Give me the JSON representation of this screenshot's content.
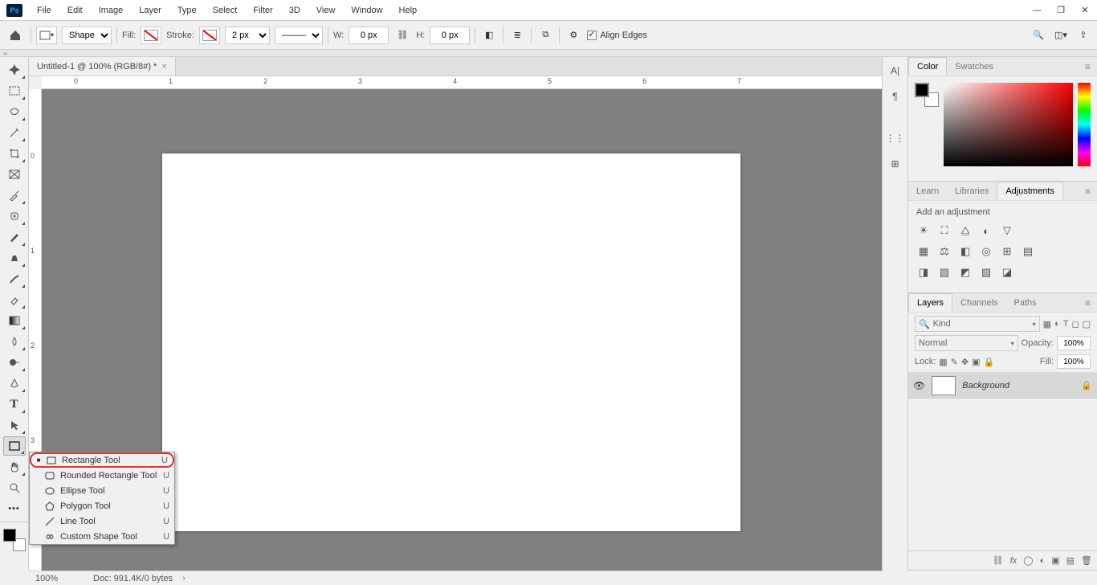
{
  "app": {
    "ps_label": "Ps"
  },
  "menu": [
    "File",
    "Edit",
    "Image",
    "Layer",
    "Type",
    "Select",
    "Filter",
    "3D",
    "View",
    "Window",
    "Help"
  ],
  "options": {
    "mode": "Shape",
    "fill_label": "Fill:",
    "stroke_label": "Stroke:",
    "stroke_width": "2 px",
    "w_label": "W:",
    "w_value": "0 px",
    "h_label": "H:",
    "h_value": "0 px",
    "align_edges": "Align Edges"
  },
  "document": {
    "tab_title": "Untitled-1 @ 100% (RGB/8#) *"
  },
  "ruler_h": [
    "0",
    "1",
    "2",
    "3",
    "4",
    "5",
    "6",
    "7"
  ],
  "ruler_v": [
    "0",
    "1",
    "2",
    "3"
  ],
  "collapsed_icons": [
    "A|",
    "¶",
    "⋮⋮",
    "⊞"
  ],
  "panels": {
    "color_tabs": [
      "Color",
      "Swatches"
    ],
    "learn_tabs": [
      "Learn",
      "Libraries",
      "Adjustments"
    ],
    "adj_hint": "Add an adjustment",
    "layers_tabs": [
      "Layers",
      "Channels",
      "Paths"
    ],
    "layers": {
      "kind_label": "Kind",
      "blend_mode": "Normal",
      "opacity_label": "Opacity:",
      "opacity_value": "100%",
      "lock_label": "Lock:",
      "fill_label": "Fill:",
      "fill_value": "100%",
      "layer_name": "Background"
    }
  },
  "flyout": [
    {
      "bullet": "■",
      "label": "Rectangle Tool",
      "key": "U"
    },
    {
      "bullet": "",
      "label": "Rounded Rectangle Tool",
      "key": "U"
    },
    {
      "bullet": "",
      "label": "Ellipse Tool",
      "key": "U"
    },
    {
      "bullet": "",
      "label": "Polygon Tool",
      "key": "U"
    },
    {
      "bullet": "",
      "label": "Line Tool",
      "key": "U"
    },
    {
      "bullet": "",
      "label": "Custom Shape Tool",
      "key": "U"
    }
  ],
  "status": {
    "zoom": "100%",
    "doc_info": "Doc: 991.4K/0 bytes"
  }
}
